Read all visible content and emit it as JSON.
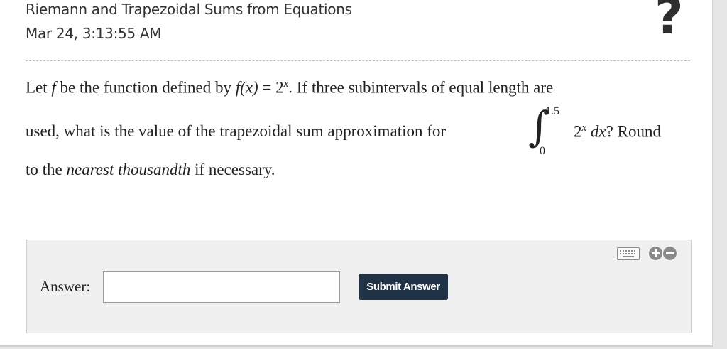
{
  "header": {
    "title": "Riemann and Trapezoidal Sums from Equations",
    "date": "Mar 24, 3:13:55 AM",
    "help_glyph": "?"
  },
  "question": {
    "line1": {
      "t1": "Let ",
      "f": "f",
      "t2": " be the function defined by ",
      "fx": "f(x)",
      "eq": " = 2",
      "sup": "x",
      "t3": ". If three subintervals of equal length are"
    },
    "line2": {
      "t1": "used, what is the value of the trapezoidal sum approximation for"
    },
    "integral": {
      "sign": "∫",
      "upper": "1.5",
      "lower": "0",
      "base": "2",
      "sup": "x",
      "dx": " dx",
      "after": "? Round"
    },
    "line3": {
      "t1": "to the ",
      "em": "nearest thousandth",
      "t2": " if necessary."
    }
  },
  "answer": {
    "label": "Answer:",
    "value": "",
    "placeholder": "",
    "submit_label": "Submit Answer"
  },
  "icons": {
    "keyboard": "keyboard-icon",
    "plus": "plus-circle-icon",
    "minus": "minus-circle-icon",
    "help": "question-mark-icon"
  }
}
